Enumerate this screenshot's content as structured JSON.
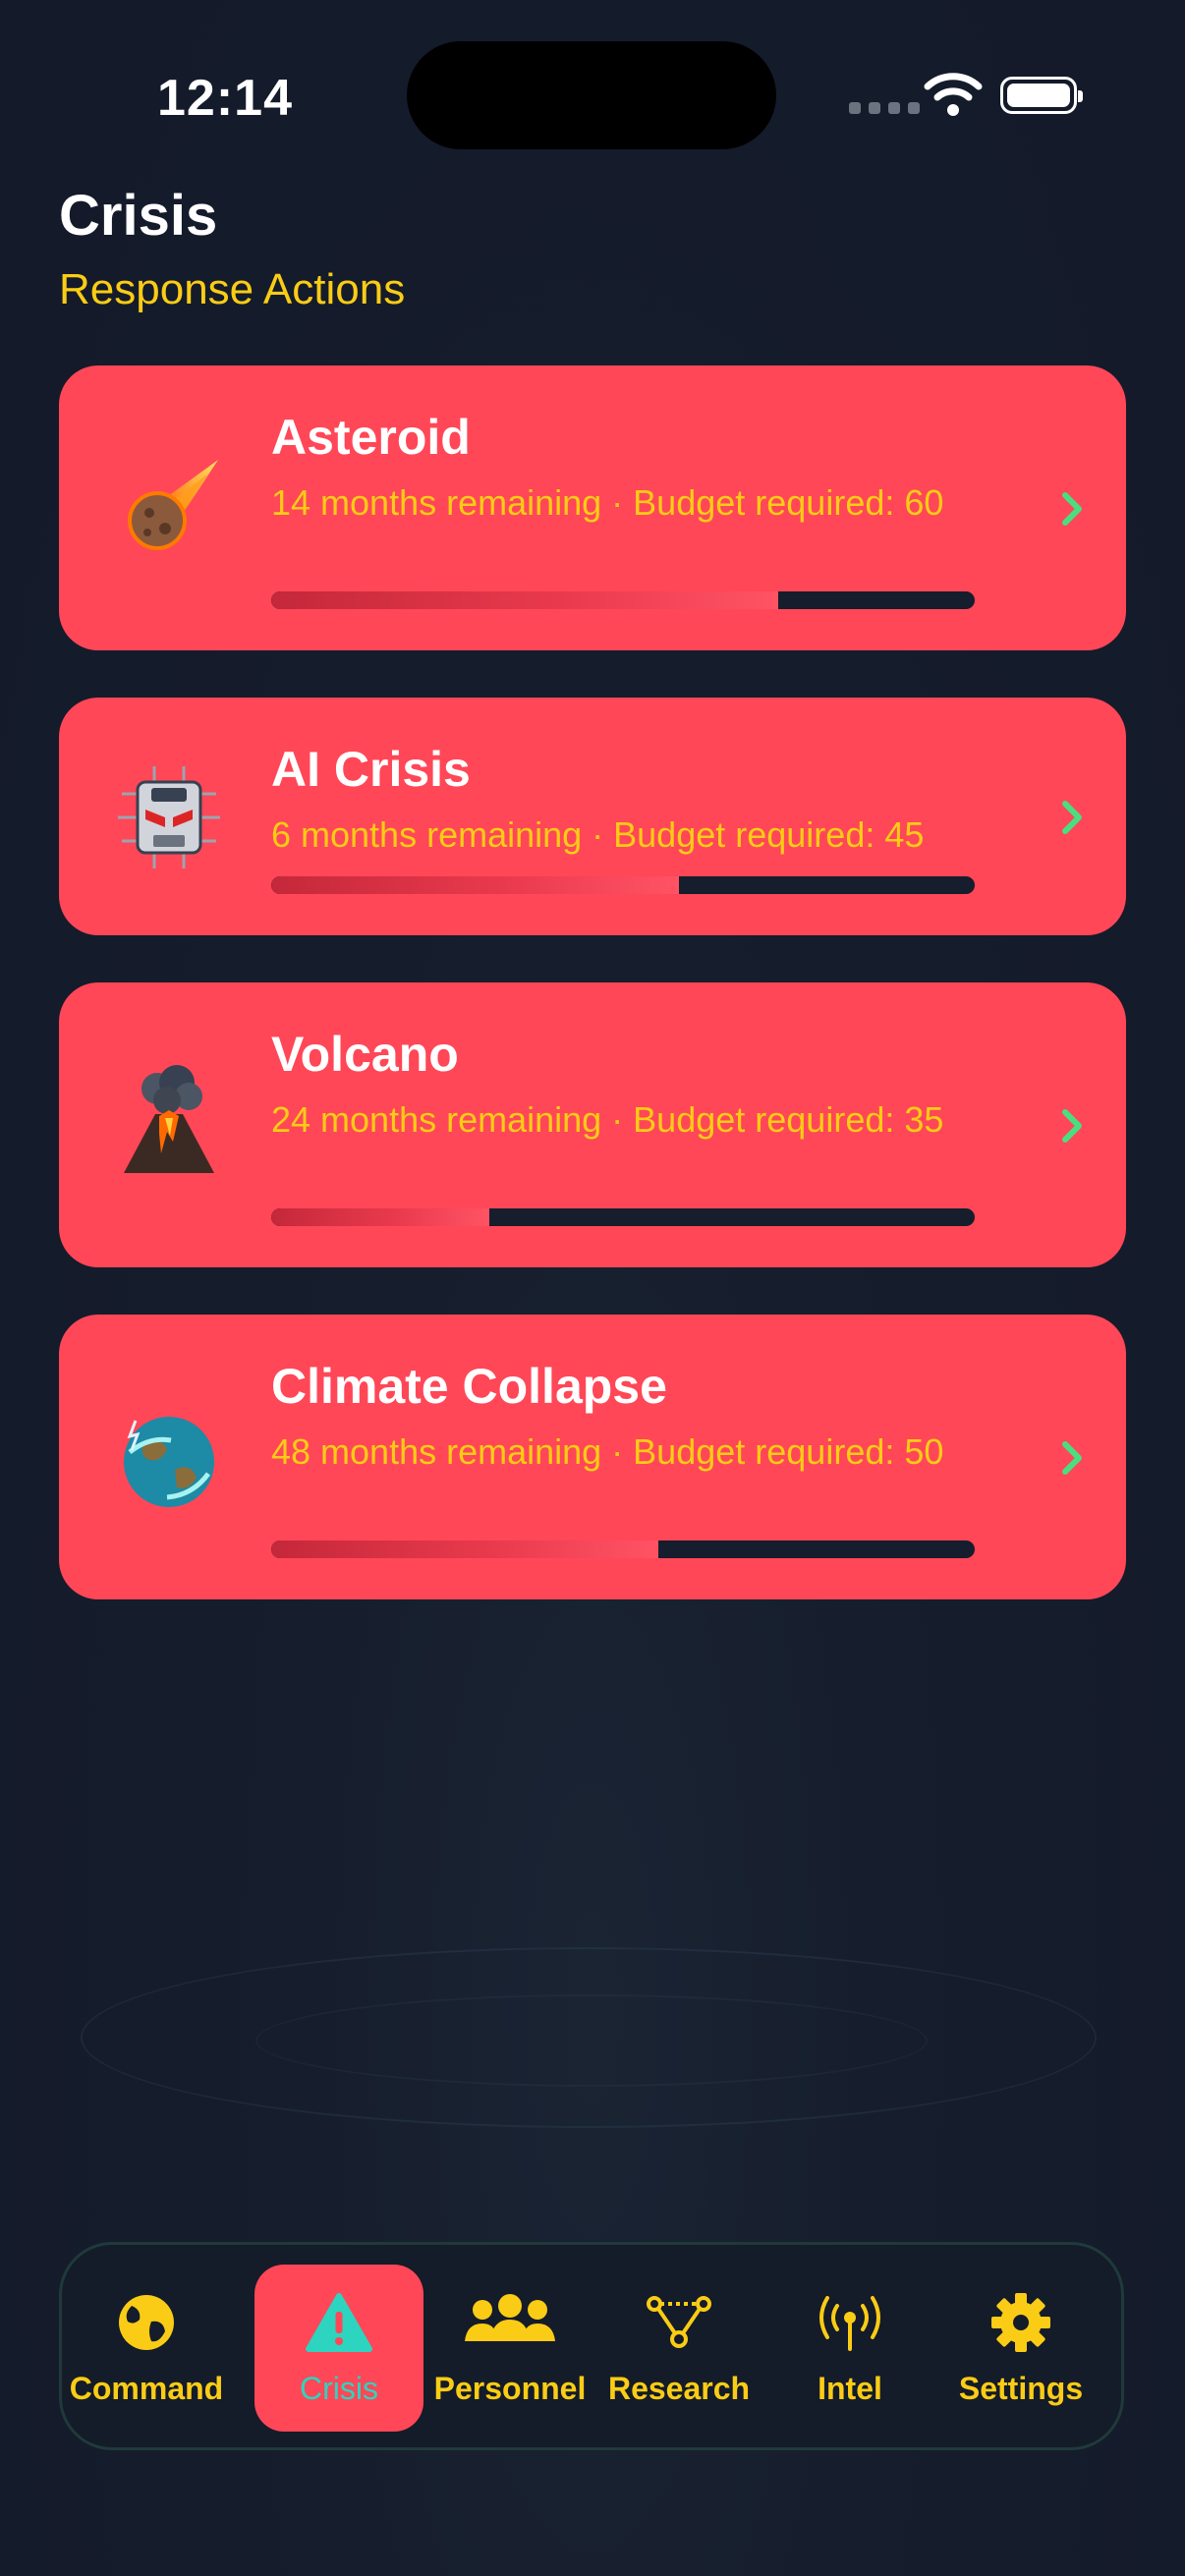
{
  "status_bar": {
    "time": "12:14"
  },
  "header": {
    "title": "Crisis",
    "subtitle": "Response Actions"
  },
  "crises": [
    {
      "name": "Asteroid",
      "meta": "14 months remaining · Budget required: 60",
      "progress": 0.72,
      "icon": "meteor-icon"
    },
    {
      "name": "AI Crisis",
      "meta": "6 months remaining · Budget required: 45",
      "progress": 0.58,
      "icon": "ai-chip-icon"
    },
    {
      "name": "Volcano",
      "meta": "24 months remaining · Budget required: 35",
      "progress": 0.31,
      "icon": "volcano-icon"
    },
    {
      "name": "Climate Collapse",
      "meta": "48 months remaining · Budget required: 50",
      "progress": 0.55,
      "icon": "stormy-earth-icon"
    }
  ],
  "tabs": [
    {
      "label": "Command",
      "icon": "globe-icon",
      "active": false
    },
    {
      "label": "Crisis",
      "icon": "warning-icon",
      "active": true
    },
    {
      "label": "Personnel",
      "icon": "people-icon",
      "active": false
    },
    {
      "label": "Research",
      "icon": "network-icon",
      "active": false
    },
    {
      "label": "Intel",
      "icon": "antenna-icon",
      "active": false
    },
    {
      "label": "Settings",
      "icon": "gear-icon",
      "active": false
    }
  ],
  "colors": {
    "card": "#ff4757",
    "accent_yellow": "#facc15",
    "chevron_green": "#4ade80",
    "active_tab_text": "#2dd4bf",
    "background": "#151c2c"
  }
}
